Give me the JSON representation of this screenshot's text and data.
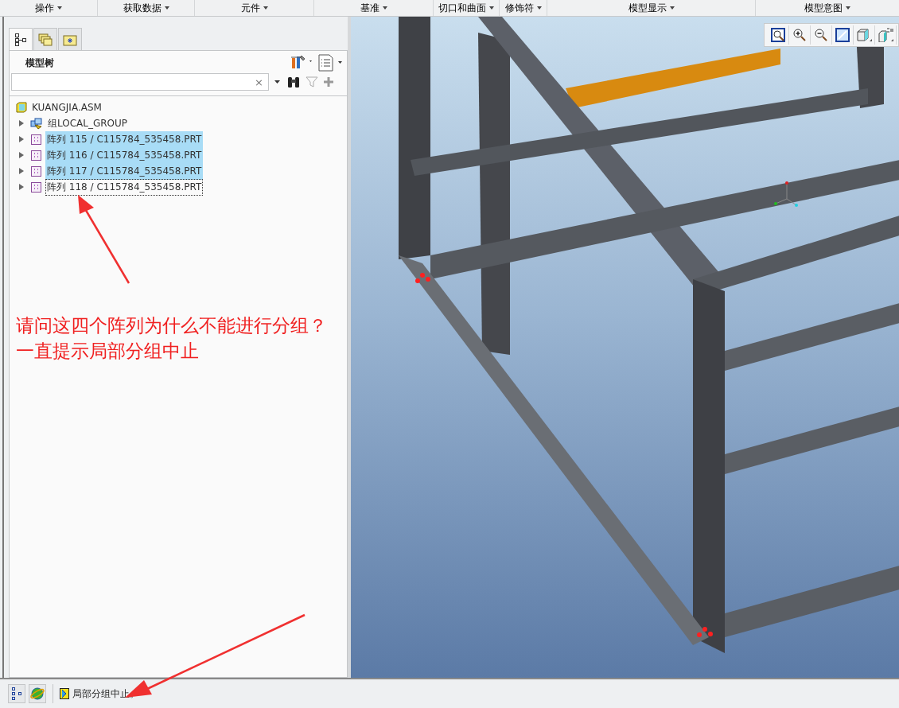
{
  "menu_bar": [
    {
      "label": "操作"
    },
    {
      "label": "获取数据"
    },
    {
      "label": "元件"
    },
    {
      "label": "基准"
    },
    {
      "label": "切口和曲面"
    },
    {
      "label": "修饰符"
    },
    {
      "label": "模型显示"
    },
    {
      "label": "模型意图"
    }
  ],
  "model_tree": {
    "tabs": [
      {
        "kind": "tree",
        "selected": true
      },
      {
        "kind": "layers",
        "selected": false
      },
      {
        "kind": "favorites",
        "selected": false
      }
    ],
    "title": "模型树",
    "search": {
      "clear_glyph": "×"
    },
    "root": {
      "label": "KUANGJIA.ASM",
      "kind": "assembly"
    },
    "items": [
      {
        "label": "组LOCAL_GROUP",
        "kind": "group",
        "selected": false,
        "focused": false
      },
      {
        "label": "阵列 115 / C115784_535458.PRT",
        "kind": "pattern",
        "selected": true,
        "focused": false
      },
      {
        "label": "阵列 116 / C115784_535458.PRT",
        "kind": "pattern",
        "selected": true,
        "focused": false
      },
      {
        "label": "阵列 117 / C115784_535458.PRT",
        "kind": "pattern",
        "selected": true,
        "focused": false
      },
      {
        "label": "阵列 118 / C115784_535458.PRT",
        "kind": "pattern",
        "selected": false,
        "focused": true
      }
    ]
  },
  "viewport_toolbar": [
    {
      "kind": "refit"
    },
    {
      "kind": "zoom-in"
    },
    {
      "kind": "zoom-out"
    },
    {
      "kind": "repaint"
    },
    {
      "kind": "display-style"
    },
    {
      "kind": "saved-views"
    }
  ],
  "annotation": {
    "lines": [
      "请问这四个阵列为什么不能进行分组？",
      "一直提示局部分组中止"
    ]
  },
  "status_bar": {
    "message": "局部分组中止。"
  }
}
